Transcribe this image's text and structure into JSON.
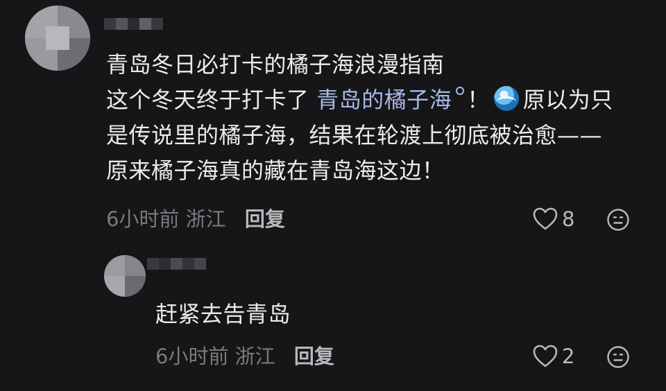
{
  "comments": [
    {
      "title": "青岛冬日必打卡的橘子海浪漫指南",
      "line1_pre": "这个冬天终于打卡了 ",
      "line1_link": "青岛的橘子海",
      "line1_post_a": "！",
      "line1_post_b": "原以为只",
      "line2": "是传说里的橘子海，结果在轮渡上彻底被治愈——",
      "line3": "原来橘子海真的藏在青岛海这边！",
      "time": "6小时前",
      "location": "浙江",
      "reply_label": "回复",
      "like_count": "8",
      "icons": [
        "heart-outline-icon",
        "dislike-face-icon",
        "water-wave-emoji",
        "link-badge-icon"
      ]
    },
    {
      "text": "赶紧去告青岛",
      "time": "6小时前",
      "location": "浙江",
      "reply_label": "回复",
      "like_count": "2",
      "icons": [
        "heart-outline-icon",
        "dislike-face-icon"
      ]
    }
  ],
  "colors": {
    "background": "#161618",
    "text": "#ececec",
    "link": "#a8b8e8",
    "meta": "#7a7a7e"
  }
}
